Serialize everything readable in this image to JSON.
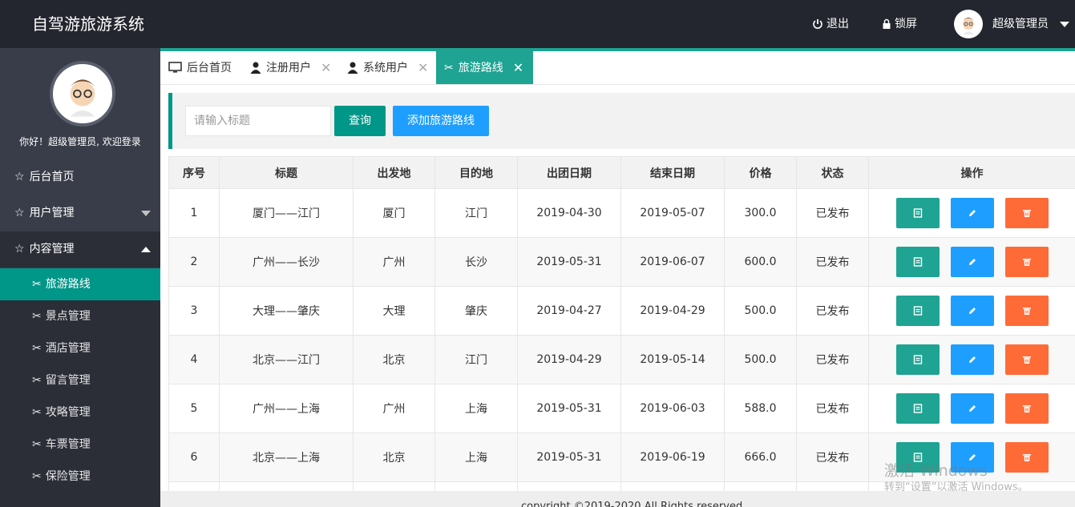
{
  "header": {
    "title": "自驾游旅游系统",
    "logout_label": "退出",
    "lock_label": "锁屏",
    "user_name": "超级管理员"
  },
  "sidebar": {
    "welcome": "你好！超级管理员, 欢迎登录",
    "items": [
      {
        "label": "后台首页",
        "icon": "star-outline-icon"
      },
      {
        "label": "用户管理",
        "icon": "star-outline-icon"
      },
      {
        "label": "内容管理",
        "icon": "star-outline-icon"
      }
    ],
    "sub_items": [
      {
        "label": "旅游路线",
        "active": true
      },
      {
        "label": "景点管理"
      },
      {
        "label": "酒店管理"
      },
      {
        "label": "留言管理"
      },
      {
        "label": "攻略管理"
      },
      {
        "label": "车票管理"
      },
      {
        "label": "保险管理"
      }
    ]
  },
  "tabs": [
    {
      "label": "后台首页",
      "icon": "monitor-icon"
    },
    {
      "label": "注册用户",
      "icon": "user-icon",
      "close": "✕"
    },
    {
      "label": "系统用户",
      "icon": "user-icon",
      "close": "✕"
    },
    {
      "label": "旅游路线",
      "icon": "route-icon",
      "close": "✕",
      "active": true
    }
  ],
  "search": {
    "placeholder": "请输入标题",
    "query_label": "查询",
    "add_label": "添加旅游路线"
  },
  "table": {
    "headers": [
      "序号",
      "标题",
      "出发地",
      "目的地",
      "出团日期",
      "结束日期",
      "价格",
      "状态",
      "操作"
    ],
    "rows": [
      [
        "1",
        "厦门——江门",
        "厦门",
        "江门",
        "2019-04-30",
        "2019-05-07",
        "300.0",
        "已发布"
      ],
      [
        "2",
        "广州——长沙",
        "广州",
        "长沙",
        "2019-05-31",
        "2019-06-07",
        "600.0",
        "已发布"
      ],
      [
        "3",
        "大理——肇庆",
        "大理",
        "肇庆",
        "2019-04-27",
        "2019-04-29",
        "500.0",
        "已发布"
      ],
      [
        "4",
        "北京——江门",
        "北京",
        "江门",
        "2019-04-29",
        "2019-05-14",
        "500.0",
        "已发布"
      ],
      [
        "5",
        "广州——上海",
        "广州",
        "上海",
        "2019-05-31",
        "2019-06-03",
        "588.0",
        "已发布"
      ],
      [
        "6",
        "北京——上海",
        "北京",
        "上海",
        "2019-05-31",
        "2019-06-19",
        "666.0",
        "已发布"
      ]
    ]
  },
  "footer": {
    "text": "copyright ©2019-2020 All Rights reserved"
  },
  "watermark": {
    "line1": "激活 Windows",
    "line2": "转到“设置”以激活 Windows。"
  },
  "colors": {
    "header_bg": "#23262e",
    "sidebar_bg": "#393d49",
    "accent": "#009688",
    "blue": "#1e9fff",
    "orange": "#ff6b37"
  }
}
